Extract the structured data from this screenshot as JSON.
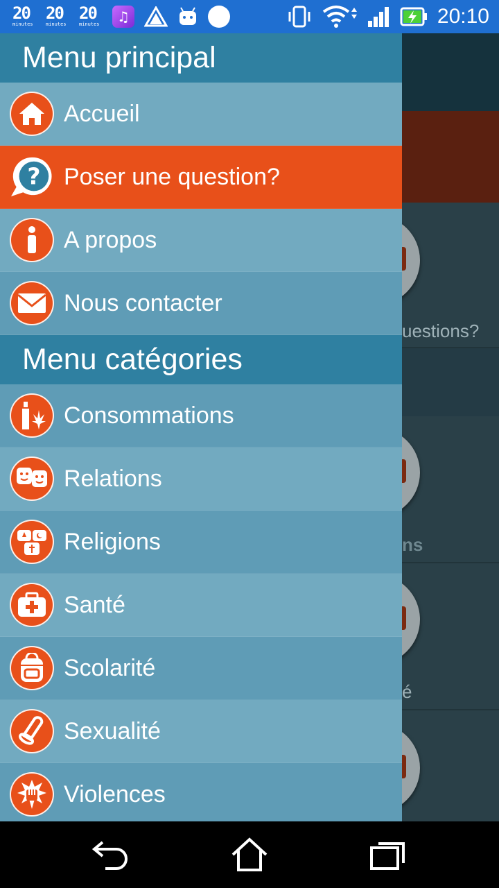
{
  "status_bar": {
    "time": "20:10",
    "left_icons": [
      "20-minutes-icon",
      "20-minutes-icon",
      "20-minutes-icon",
      "music-app-icon",
      "triangle-app-icon",
      "android-robot-icon",
      "circle-notification-icon"
    ],
    "brand_number": "20",
    "brand_caption": "minutes",
    "right_icons": [
      "vibrate-icon",
      "wifi-icon",
      "signal-icon",
      "battery-charging-icon"
    ]
  },
  "drawer": {
    "main_header": "Menu principal",
    "main_items": [
      {
        "label": "Accueil",
        "icon": "home-icon"
      },
      {
        "label": "Poser une question?",
        "icon": "question-bubble-icon",
        "active": true
      },
      {
        "label": "A propos",
        "icon": "info-icon"
      },
      {
        "label": "Nous contacter",
        "icon": "envelope-icon"
      }
    ],
    "categories_header": "Menu catégories",
    "category_items": [
      {
        "label": "Consommations",
        "icon": "bottle-leaf-icon"
      },
      {
        "label": "Relations",
        "icon": "faces-bubble-icon"
      },
      {
        "label": "Religions",
        "icon": "religion-symbols-icon"
      },
      {
        "label": "Santé",
        "icon": "medical-kit-icon"
      },
      {
        "label": "Scolarité",
        "icon": "backpack-icon"
      },
      {
        "label": "Sexualité",
        "icon": "condom-icon"
      },
      {
        "label": "Violences",
        "icon": "fist-icon"
      }
    ]
  },
  "background": {
    "peek_text_1": "uestions?",
    "peek_text_2": "ns",
    "peek_text_3": "é"
  },
  "nav_bar": {
    "icons": [
      "back-icon",
      "home-nav-icon",
      "recents-icon"
    ]
  },
  "colors": {
    "status_bar": "#1f6fd1",
    "header": "#2f80a1",
    "item_light": "#72aac0",
    "item_dark": "#5f9cb6",
    "accent": "#e8501a"
  }
}
